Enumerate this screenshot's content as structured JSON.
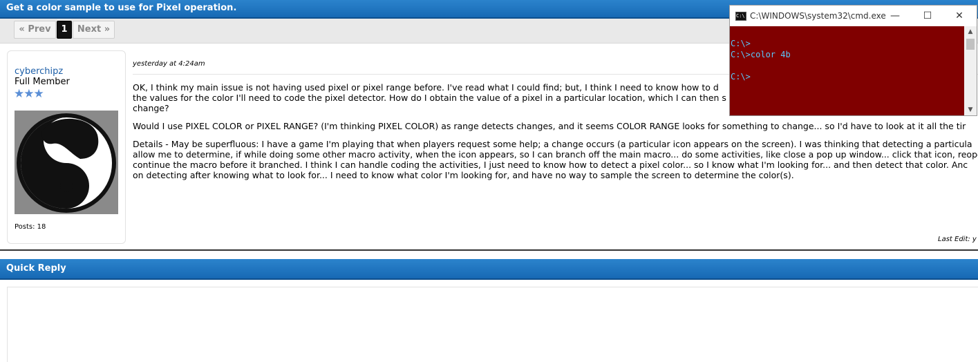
{
  "topic": {
    "title": "Get a color sample to use for Pixel operation."
  },
  "pager": {
    "prev": "« Prev",
    "current": "1",
    "next": "Next »"
  },
  "post": {
    "author": "cyberchipz",
    "rank": "Full Member",
    "stars": "★★★",
    "posts": "Posts: 18",
    "date": "yesterday at 4:24am",
    "paragraphs": [
      "OK, I think my main issue is not having used pixel or pixel range before.  I've read what I could find; but, I think I need to know how to d",
      "the values for the color I'll need to code the pixel detector.  How do I obtain the value of a pixel in a particular location, which I can then s",
      "change?",
      "Would I use PIXEL COLOR or PIXEL RANGE?   (I'm thinking PIXEL COLOR) as range detects changes, and it seems COLOR RANGE looks for something to change... so I'd have to look at it all the tir",
      "Details - May be superfluous: I have a game I'm playing that when players request some help; a change occurs (a particular icon appears on the screen). I was thinking that detecting a particula",
      "allow me to determine, if while doing some other macro activity, when the icon appears, so I can branch off the main macro... do some activities, like close a pop up window... click that icon, reope",
      "continue the macro before it branched.  I think I can handle coding the activities, I just need to know how to detect a pixel color... so I know what I'm looking for... and then detect that color.  Anc",
      "on detecting after knowing what to look for... I need to know what color I'm looking for, and have no way to sample the screen to determine the color(s)."
    ],
    "last_edit": "Last Edit: y"
  },
  "quick_reply": {
    "title": "Quick Reply"
  },
  "cmd": {
    "title": "C:\\WINDOWS\\system32\\cmd.exe",
    "icon_text": "C:\\",
    "minimize": "—",
    "maximize": "☐",
    "close": "✕",
    "lines": [
      "C:\\>",
      "C:\\>color 4b",
      "",
      "C:\\>"
    ]
  },
  "colors": {
    "header_blue": "#1f76c2",
    "console_bg": "#800000",
    "console_fg": "#5ac8fa",
    "link": "#1d5fa8"
  }
}
